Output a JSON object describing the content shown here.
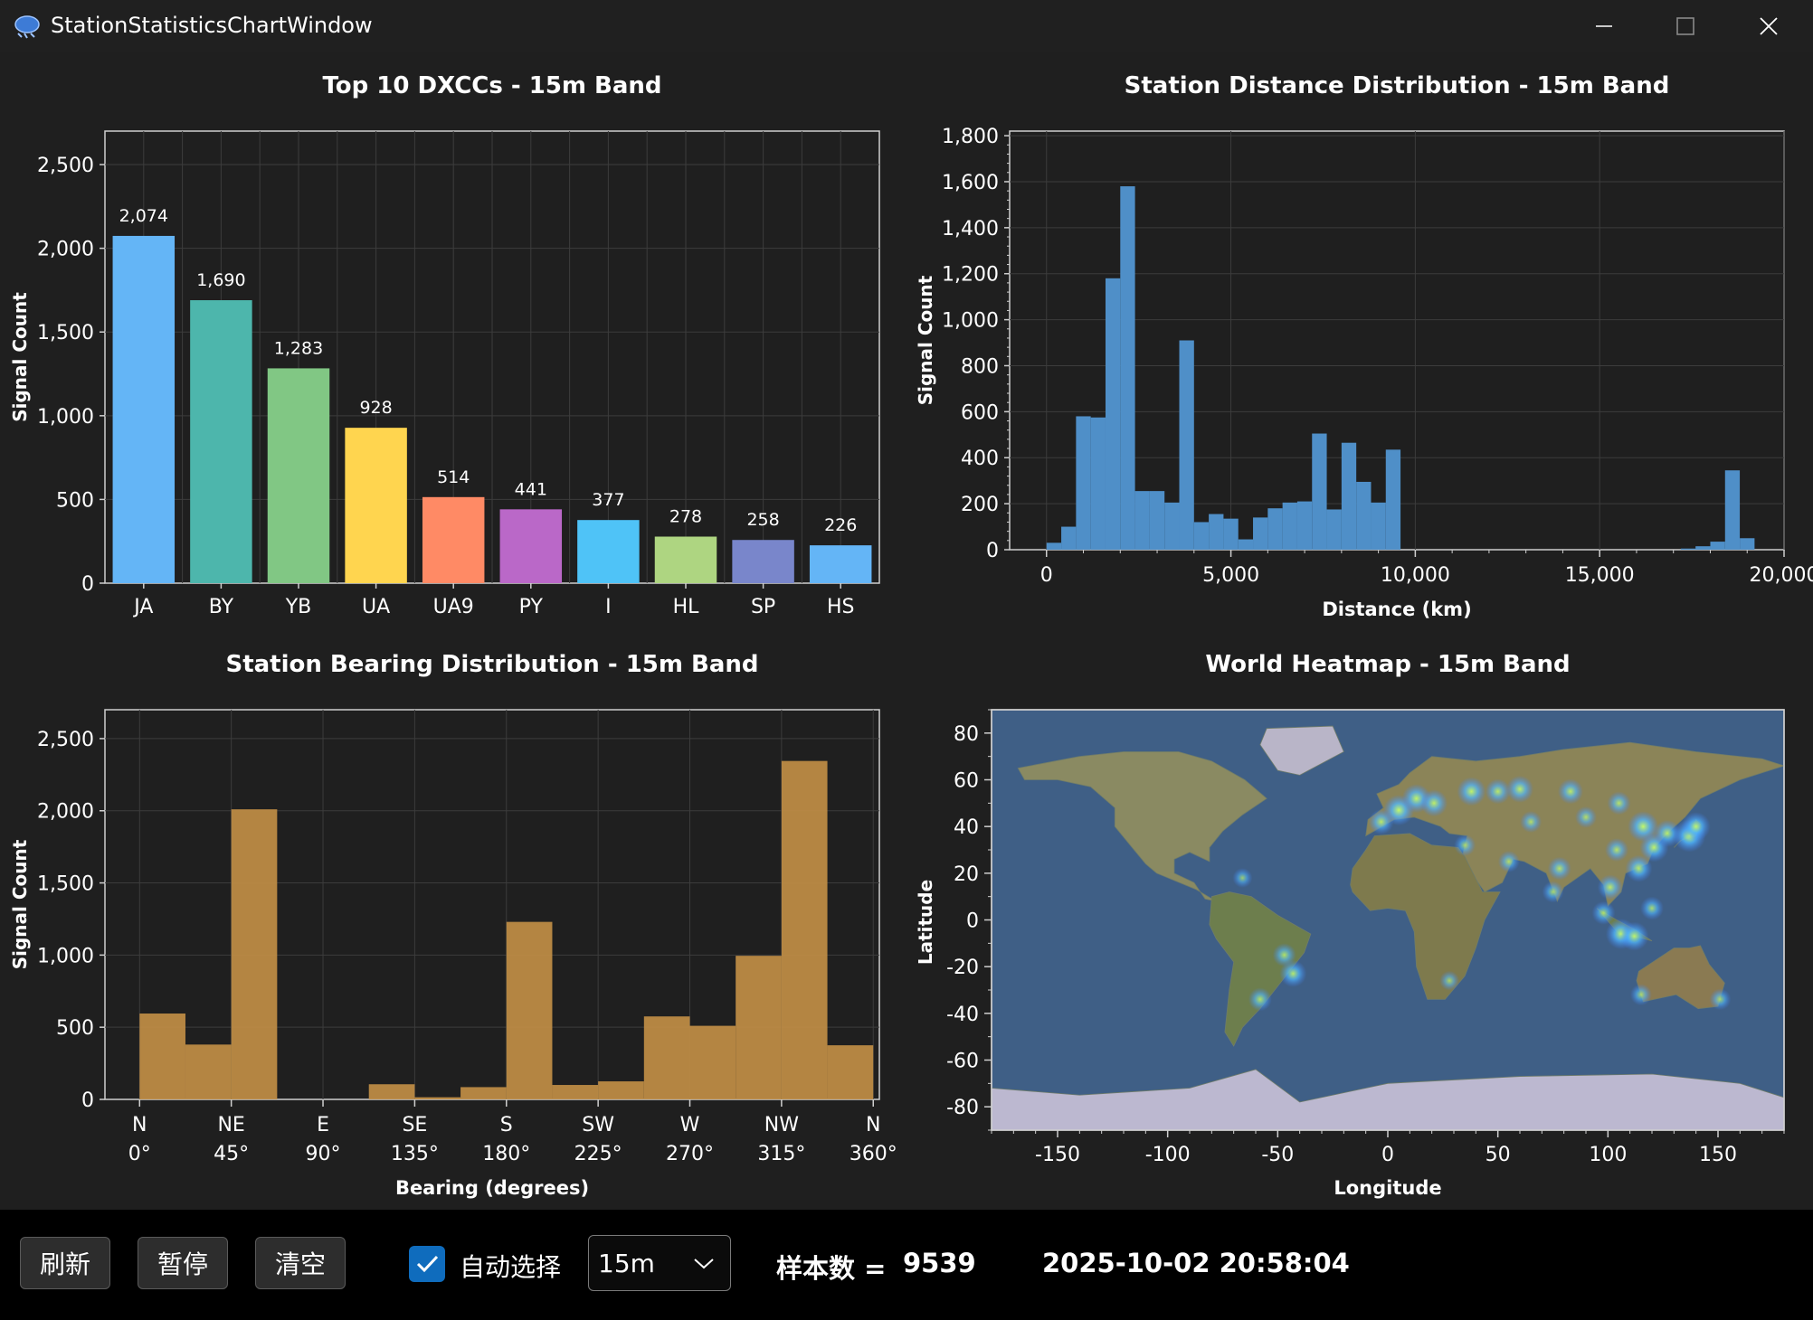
{
  "window": {
    "title": "StationStatisticsChartWindow"
  },
  "colors": {
    "plot_bg": "#1f1f1f",
    "grid": "#3c3c3c",
    "axis": "#cfcfcf",
    "bearing_bar": "#c18e45",
    "distance_bar": "#4f8fc8"
  },
  "chart_data": [
    {
      "type": "bar",
      "title": "Top 10 DXCCs - 15m Band",
      "xlabel": "",
      "ylabel": "Signal Count",
      "ylim": [
        0,
        2700
      ],
      "yticks": [
        0,
        500,
        1000,
        1500,
        2000,
        2500
      ],
      "ytick_labels": [
        "0",
        "500",
        "1,000",
        "1,500",
        "2,000",
        "2,500"
      ],
      "categories": [
        "JA",
        "BY",
        "YB",
        "UA",
        "UA9",
        "PY",
        "I",
        "HL",
        "SP",
        "HS"
      ],
      "values": [
        2074,
        1690,
        1283,
        928,
        514,
        441,
        377,
        278,
        258,
        226
      ],
      "value_labels": [
        "2,074",
        "1,690",
        "1,283",
        "928",
        "514",
        "441",
        "377",
        "278",
        "258",
        "226"
      ],
      "colors": [
        "#64b5f6",
        "#4db6ac",
        "#81c784",
        "#ffd54f",
        "#ff8a65",
        "#ba68c8",
        "#4fc3f7",
        "#aed581",
        "#7986cb",
        "#64b5f6"
      ],
      "grid": true
    },
    {
      "type": "bar",
      "title": "Station Distance Distribution - 15m Band",
      "xlabel": "Distance (km)",
      "ylabel": "Signal Count",
      "xlim": [
        -1000,
        20000
      ],
      "ylim": [
        0,
        1820
      ],
      "xticks": [
        0,
        5000,
        10000,
        15000,
        20000
      ],
      "xtick_labels": [
        "0",
        "5,000",
        "10,000",
        "15,000",
        "20,000"
      ],
      "yticks": [
        0,
        200,
        400,
        600,
        800,
        1000,
        1200,
        1400,
        1600,
        1800
      ],
      "ytick_labels": [
        "0",
        "200",
        "400",
        "600",
        "800",
        "1,000",
        "1,200",
        "1,400",
        "1,600",
        "1,800"
      ],
      "bin_width": 400,
      "bins": [
        [
          0,
          30
        ],
        [
          400,
          100
        ],
        [
          800,
          580
        ],
        [
          1200,
          575
        ],
        [
          1600,
          1180
        ],
        [
          2000,
          1580
        ],
        [
          2400,
          255
        ],
        [
          2800,
          255
        ],
        [
          3200,
          205
        ],
        [
          3600,
          910
        ],
        [
          4000,
          120
        ],
        [
          4400,
          155
        ],
        [
          4800,
          135
        ],
        [
          5200,
          45
        ],
        [
          5600,
          140
        ],
        [
          6000,
          180
        ],
        [
          6400,
          205
        ],
        [
          6800,
          210
        ],
        [
          7200,
          505
        ],
        [
          7600,
          175
        ],
        [
          8000,
          465
        ],
        [
          8400,
          295
        ],
        [
          8800,
          205
        ],
        [
          9200,
          435
        ],
        [
          17200,
          5
        ],
        [
          17600,
          15
        ],
        [
          18000,
          35
        ],
        [
          18400,
          345
        ],
        [
          18800,
          50
        ]
      ],
      "grid": true
    },
    {
      "type": "bar",
      "title": "Station Bearing Distribution - 15m Band",
      "xlabel": "Bearing (degrees)",
      "ylabel": "Signal Count",
      "xlim": [
        -17,
        363
      ],
      "ylim": [
        0,
        2700
      ],
      "xticks": [
        0,
        45,
        90,
        135,
        180,
        225,
        270,
        315,
        360
      ],
      "xtick_labels": [
        "N",
        "NE",
        "E",
        "SE",
        "S",
        "SW",
        "W",
        "NW",
        "N"
      ],
      "xtick_sublabels": [
        "0°",
        "45°",
        "90°",
        "135°",
        "180°",
        "225°",
        "270°",
        "315°",
        "360°"
      ],
      "yticks": [
        0,
        500,
        1000,
        1500,
        2000,
        2500
      ],
      "ytick_labels": [
        "0",
        "500",
        "1,000",
        "1,500",
        "2,000",
        "2,500"
      ],
      "bin_width": 22.5,
      "values": [
        595,
        380,
        2010,
        0,
        0,
        105,
        15,
        85,
        1230,
        100,
        125,
        575,
        510,
        995,
        2345,
        375
      ],
      "grid": true
    },
    {
      "type": "heatmap",
      "title": "World Heatmap - 15m Band",
      "xlabel": "Longitude",
      "ylabel": "Latitude",
      "xlim": [
        -180,
        180
      ],
      "ylim": [
        -90,
        90
      ],
      "xticks": [
        -150,
        -100,
        -50,
        0,
        50,
        100,
        150
      ],
      "xtick_labels": [
        "-150",
        "-100",
        "-50",
        "0",
        "50",
        "100",
        "150"
      ],
      "yticks": [
        80,
        60,
        40,
        20,
        0,
        -20,
        -40,
        -60,
        -80
      ],
      "ytick_labels": [
        "80",
        "60",
        "40",
        "20",
        "0",
        "-20",
        "-40",
        "-60",
        "-80"
      ],
      "background": "world map",
      "hotspots": [
        {
          "lon": 5,
          "lat": 47,
          "intensity": 0.9
        },
        {
          "lon": 13,
          "lat": 52,
          "intensity": 0.8
        },
        {
          "lon": -3,
          "lat": 42,
          "intensity": 0.6
        },
        {
          "lon": 21,
          "lat": 50,
          "intensity": 0.7
        },
        {
          "lon": 38,
          "lat": 55,
          "intensity": 0.8
        },
        {
          "lon": 50,
          "lat": 55,
          "intensity": 0.6
        },
        {
          "lon": 60,
          "lat": 56,
          "intensity": 0.7
        },
        {
          "lon": 83,
          "lat": 55,
          "intensity": 0.6
        },
        {
          "lon": 105,
          "lat": 50,
          "intensity": 0.5
        },
        {
          "lon": 116,
          "lat": 40,
          "intensity": 0.9
        },
        {
          "lon": 121,
          "lat": 31,
          "intensity": 0.8
        },
        {
          "lon": 127,
          "lat": 37,
          "intensity": 0.7
        },
        {
          "lon": 137,
          "lat": 36,
          "intensity": 1.0
        },
        {
          "lon": 140,
          "lat": 40,
          "intensity": 0.8
        },
        {
          "lon": 114,
          "lat": 22,
          "intensity": 0.7
        },
        {
          "lon": 104,
          "lat": 30,
          "intensity": 0.5
        },
        {
          "lon": 101,
          "lat": 14,
          "intensity": 0.6
        },
        {
          "lon": 106,
          "lat": -6,
          "intensity": 0.9
        },
        {
          "lon": 112,
          "lat": -7,
          "intensity": 0.8
        },
        {
          "lon": 98,
          "lat": 3,
          "intensity": 0.5
        },
        {
          "lon": 120,
          "lat": 5,
          "intensity": 0.5
        },
        {
          "lon": 78,
          "lat": 22,
          "intensity": 0.5
        },
        {
          "lon": 75,
          "lat": 12,
          "intensity": 0.4
        },
        {
          "lon": 55,
          "lat": 25,
          "intensity": 0.4
        },
        {
          "lon": 35,
          "lat": 32,
          "intensity": 0.4
        },
        {
          "lon": -43,
          "lat": -23,
          "intensity": 0.7
        },
        {
          "lon": -47,
          "lat": -15,
          "intensity": 0.5
        },
        {
          "lon": -58,
          "lat": -34,
          "intensity": 0.5
        },
        {
          "lon": 115,
          "lat": -32,
          "intensity": 0.4
        },
        {
          "lon": 151,
          "lat": -34,
          "intensity": 0.4
        },
        {
          "lon": -66,
          "lat": 18,
          "intensity": 0.3
        },
        {
          "lon": 28,
          "lat": -26,
          "intensity": 0.3
        },
        {
          "lon": 65,
          "lat": 42,
          "intensity": 0.4
        },
        {
          "lon": 90,
          "lat": 44,
          "intensity": 0.4
        }
      ]
    }
  ],
  "footer": {
    "refresh_label": "刷新",
    "pause_label": "暂停",
    "clear_label": "清空",
    "auto_select_label": "自动选择",
    "auto_select_checked": true,
    "band_value": "15m",
    "sample_count_label": "样本数 =",
    "sample_count_value": "9539",
    "timestamp": "2025-10-02 20:58:04"
  }
}
